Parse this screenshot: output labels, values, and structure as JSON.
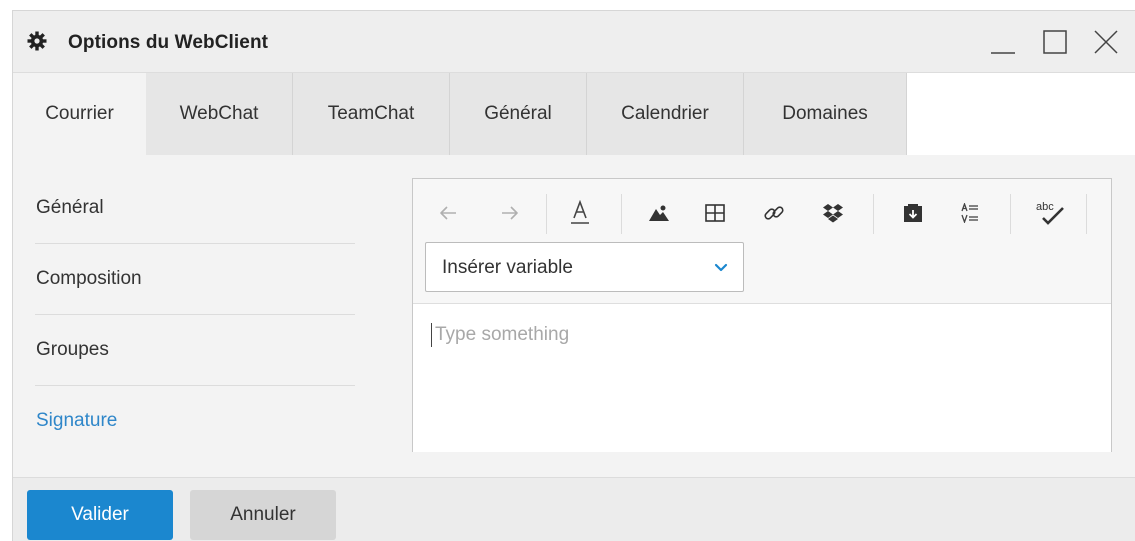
{
  "window": {
    "title": "Options du WebClient",
    "icons": {
      "title": "gear-icon",
      "minimize": "minimize-icon",
      "maximize": "maximize-icon",
      "close": "close-icon"
    }
  },
  "tabs": [
    {
      "label": "Courrier",
      "active": true
    },
    {
      "label": "WebChat",
      "active": false
    },
    {
      "label": "TeamChat",
      "active": false
    },
    {
      "label": "Général",
      "active": false
    },
    {
      "label": "Calendrier",
      "active": false
    },
    {
      "label": "Domaines",
      "active": false
    }
  ],
  "sidebar": {
    "items": [
      {
        "label": "Général",
        "active": false
      },
      {
        "label": "Composition",
        "active": false
      },
      {
        "label": "Groupes",
        "active": false
      },
      {
        "label": "Signature",
        "active": true
      }
    ]
  },
  "editor": {
    "toolbar_icons": [
      "undo-icon",
      "redo-icon",
      "font-color-icon",
      "image-icon",
      "table-icon",
      "link-icon",
      "dropbox-icon",
      "insert-file-icon",
      "paragraph-format-icon",
      "spellcheck-icon"
    ],
    "variable_select": {
      "label": "Insérer variable"
    },
    "placeholder": "Type something"
  },
  "footer": {
    "validate_label": "Valider",
    "cancel_label": "Annuler"
  },
  "colors": {
    "accent": "#1b87cf",
    "active_link": "#2e86c9"
  }
}
